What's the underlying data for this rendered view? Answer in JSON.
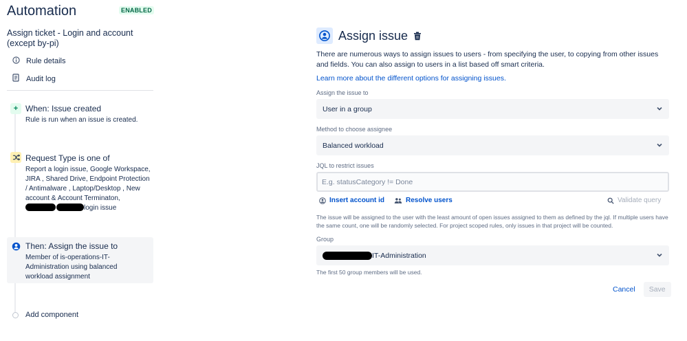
{
  "app": {
    "title": "Automation",
    "status_badge": "ENABLED"
  },
  "rule": {
    "name": "Assign ticket - Login and account (except by-pi)"
  },
  "sidebar": {
    "links": [
      {
        "icon": "info-icon",
        "label": "Rule details"
      },
      {
        "icon": "document-icon",
        "label": "Audit log"
      }
    ],
    "steps": [
      {
        "type": "trigger",
        "icon": "plus-icon",
        "title": "When: Issue created",
        "description": "Rule is run when an issue is created."
      },
      {
        "type": "condition",
        "icon": "shuffle-icon",
        "title": "Request Type is one of",
        "description": "Report a login issue, Google Workspace, JIRA , Shared Drive, Endpoint Protection / Antimalware , Laptop/Desktop , New account & Account Terminaton,",
        "description_tail": "login issue"
      },
      {
        "type": "action",
        "icon": "person-icon",
        "title": "Then: Assign the issue to",
        "description": "Member of is-operations-IT-Administration using balanced workload assignment"
      }
    ],
    "add_component": "Add component"
  },
  "panel": {
    "title": "Assign issue",
    "description": "There are numerous ways to assign issues to users - from specifying the user, to copying from other issues and fields. You can also assign to users in a list based off smart criteria.",
    "learn_more": "Learn more about the different options for assigning issues.",
    "assign_label": "Assign the issue to",
    "assign_value": "User in a group",
    "method_label": "Method to choose assignee",
    "method_value": "Balanced workload",
    "jql_label": "JQL to restrict issues",
    "jql_placeholder": "E.g. statusCategory != Done",
    "insert_account": "Insert account id",
    "resolve_users": "Resolve users",
    "validate_query": "Validate query",
    "jql_help": "The issue will be assigned to the user with the least amount of open issues assigned to them as defined by the jql. If multiple users have the same count, one will be randomly selected. For project scoped rules, only issues in that project will be counted.",
    "group_label": "Group",
    "group_value": "IT-Administration",
    "group_help": "The first 50 group members will be used.",
    "cancel": "Cancel",
    "save": "Save"
  },
  "colors": {
    "link": "#0052cc",
    "text": "#172b4d",
    "badge_bg": "#e3fcef",
    "badge_text": "#006644"
  }
}
